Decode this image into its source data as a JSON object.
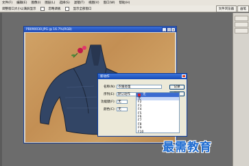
{
  "menubar": {
    "items": [
      "文件(F)",
      "编辑(E)",
      "图像(I)",
      "图层(L)",
      "选择(S)",
      "滤镜(T)",
      "视图(V)",
      "窗口(W)",
      "帮助(H)"
    ]
  },
  "options": {
    "label1": "调整窗口大小以满屏显示",
    "label2": "忽略调板",
    "label3": "显示全部窗口"
  },
  "tabs": {
    "tab1": "文件浏览器",
    "tab2": "画笔"
  },
  "image_window": {
    "title": "PB090030.JPG @ 16.7%(RGB)",
    "ctl_min": "_",
    "ctl_max": "□",
    "ctl_close": "x"
  },
  "dialog": {
    "title": "新动作",
    "name_label": "名称(N):",
    "name_value": "衣服处理",
    "set_label": "序列(E):",
    "set_value": "默认动作",
    "fkey_label": "功能键(F):",
    "fkey_value": "无",
    "shift_label": "Shift(S)",
    "color_label": "颜色(C):",
    "color_value": "无",
    "record_button": "记录",
    "cancel_button": "取消"
  },
  "dropdown": {
    "header": "无",
    "items": [
      "无",
      "F2",
      "F3",
      "F4",
      "F5",
      "F6",
      "F7",
      "F8",
      "F9",
      "F10"
    ],
    "selected_index": 0
  },
  "watermark": "最需教育"
}
